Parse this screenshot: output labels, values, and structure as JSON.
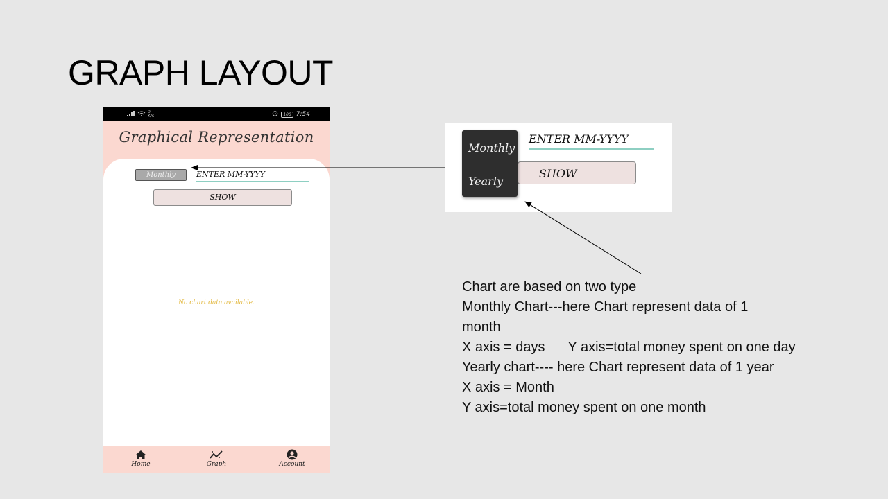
{
  "slide": {
    "title": "GRAPH LAYOUT"
  },
  "phone": {
    "status": {
      "net": "0\nK/s",
      "time": "7:54",
      "battery": "100"
    },
    "title": "Graphical Representation",
    "period_select": "Monthly",
    "date_input": {
      "value": "ENTER MM-YYYY"
    },
    "show_button": "SHOW",
    "empty_message": "No chart data available.",
    "nav": [
      {
        "label": "Home",
        "icon": "home-icon"
      },
      {
        "label": "Graph",
        "icon": "graph-icon"
      },
      {
        "label": "Account",
        "icon": "account-icon"
      }
    ]
  },
  "inset": {
    "options": [
      "Monthly",
      "Yearly"
    ],
    "date_input": "ENTER MM-YYYY",
    "show_button": "SHOW"
  },
  "notes": [
    "Chart are based on two type",
    "Monthly Chart---here Chart represent data of 1",
    "month",
    "X axis = days      Y axis=total money spent on one day",
    "Yearly chart---- here Chart represent data of 1 year",
    "X axis = Month",
    "Y axis=total money spent on one month"
  ]
}
